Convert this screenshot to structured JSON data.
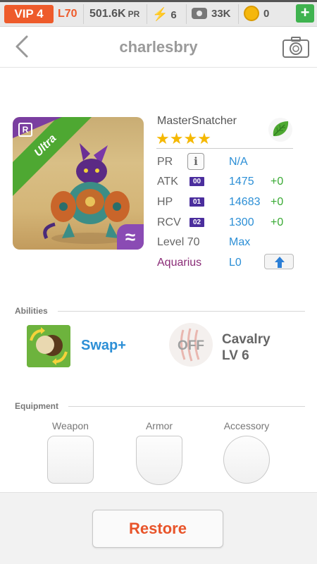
{
  "topbar": {
    "vip": "VIP 4",
    "level": "L70",
    "pr_value": "501.6K",
    "pr_unit": "PR",
    "energy": "6",
    "paw_count": "33K",
    "coins": "0",
    "plus_label": "+"
  },
  "header": {
    "title": "charlesbry"
  },
  "monster": {
    "name": "MasterSnatcher",
    "rank_label": "Ultra",
    "rarity_letter": "R",
    "element_symbol": "≈",
    "stars": "★★★★",
    "star_count": 4
  },
  "stats": {
    "pr_label": "PR",
    "pr_value": "N/A",
    "info_label": "i",
    "atk_label": "ATK",
    "atk_badge": "00",
    "atk_value": "1475",
    "atk_bonus": "+0",
    "hp_label": "HP",
    "hp_badge": "01",
    "hp_value": "14683",
    "hp_bonus": "+0",
    "rcv_label": "RCV",
    "rcv_badge": "02",
    "rcv_value": "1300",
    "rcv_bonus": "+0",
    "level_label": "Level 70",
    "level_value": "Max",
    "sign_label": "Aquarius",
    "sign_value": "L0"
  },
  "abilities": {
    "section_label": "Abilities",
    "ability_name": "Swap+",
    "skill_state": "OFF",
    "skill_name": "Cavalry",
    "skill_level": "LV 6"
  },
  "equipment": {
    "section_label": "Equipment",
    "weapon_label": "Weapon",
    "armor_label": "Armor",
    "accessory_label": "Accessory"
  },
  "footer": {
    "restore_label": "Restore"
  },
  "colors": {
    "accent_orange": "#ee5b2b",
    "value_blue": "#2c8fd6",
    "bonus_green": "#3aaa35",
    "aquarius_purple": "#8a2c77",
    "ultra_green": "#4ea832"
  }
}
